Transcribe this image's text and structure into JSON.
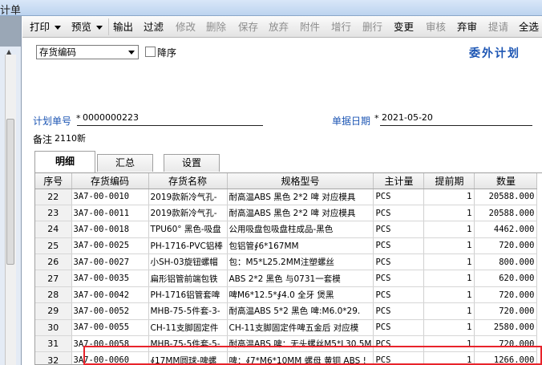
{
  "window": {
    "title": "计单"
  },
  "toolbar": {
    "buttons": [
      {
        "label": "打印",
        "dropdown": true,
        "disabled": false
      },
      {
        "label": "预览",
        "dropdown": true,
        "disabled": false
      },
      {
        "label": "输出",
        "dropdown": false,
        "disabled": false
      },
      {
        "label": "过滤",
        "dropdown": false,
        "disabled": false
      },
      {
        "label": "修改",
        "dropdown": false,
        "disabled": true
      },
      {
        "label": "删除",
        "dropdown": false,
        "disabled": true
      },
      {
        "label": "保存",
        "dropdown": false,
        "disabled": true
      },
      {
        "label": "放弃",
        "dropdown": false,
        "disabled": true
      },
      {
        "label": "附件",
        "dropdown": false,
        "disabled": true
      },
      {
        "label": "增行",
        "dropdown": false,
        "disabled": true
      },
      {
        "label": "删行",
        "dropdown": false,
        "disabled": true
      },
      {
        "label": "变更",
        "dropdown": false,
        "disabled": false
      },
      {
        "label": "审核",
        "dropdown": false,
        "disabled": true
      },
      {
        "label": "弃审",
        "dropdown": false,
        "disabled": false
      },
      {
        "label": "提请",
        "dropdown": false,
        "disabled": true
      },
      {
        "label": "全选",
        "dropdown": false,
        "disabled": false
      }
    ]
  },
  "filter": {
    "select_value": "存货编码",
    "checkbox_label": "降序",
    "checked": false
  },
  "form": {
    "title": "委外计划",
    "plan_no_label": "计划单号",
    "plan_no_value": "0000000223",
    "doc_date_label": "单据日期",
    "doc_date_value": "2021-05-20",
    "remark_label": "备注",
    "remark_value": "2110新",
    "required_mark": "*"
  },
  "tabs": [
    {
      "label": "明细",
      "active": true
    },
    {
      "label": "汇总",
      "active": false
    },
    {
      "label": "设置",
      "active": false
    }
  ],
  "table": {
    "columns": [
      "序号",
      "存货编码",
      "存货名称",
      "规格型号",
      "主计量",
      "提前期",
      "数量"
    ],
    "rows": [
      [
        "22",
        "3A7-00-0010",
        "2019款新冷气孔-",
        "耐高温ABS 黑色 2*2 啤 对应模具",
        "PCS",
        "1",
        "20588.000"
      ],
      [
        "23",
        "3A7-00-0011",
        "2019款新冷气孔-",
        "耐高温ABS 黑色 2*2 啤 对应模具",
        "PCS",
        "1",
        "20588.000"
      ],
      [
        "24",
        "3A7-00-0018",
        "TPU60° 黑色-吸盘",
        "公用吸盘包吸盘柱成品-黑色",
        "PCS",
        "1",
        "4462.000"
      ],
      [
        "25",
        "3A7-00-0025",
        "PH-1716-PVC铝棒",
        "包铝管∮6*167MM",
        "PCS",
        "1",
        "720.000"
      ],
      [
        "26",
        "3A7-00-0027",
        "小SH-03旋钮螺帽",
        "包：M5*L25.2MM注塑螺丝",
        "PCS",
        "1",
        "800.000"
      ],
      [
        "27",
        "3A7-00-0035",
        "扁形铝管前端包铁",
        "ABS 2*2 黑色 与0731一套模",
        "PCS",
        "1",
        "620.000"
      ],
      [
        "28",
        "3A7-00-0042",
        "PH-1716铝管套啤",
        "啤M6*12.5*∮4.0 全牙 煲黑",
        "PCS",
        "1",
        "720.000"
      ],
      [
        "29",
        "3A7-00-0052",
        "MHB-75-5件套-3-",
        "耐高温ABS 5*2 黑色 啤:M6.0*29.",
        "PCS",
        "1",
        "720.000"
      ],
      [
        "30",
        "3A7-00-0055",
        "CH-11支脚固定件",
        "CH-11支脚固定件啤五金后 对应模",
        "PCS",
        "1",
        "2580.000"
      ],
      [
        "31",
        "3A7-00-0058",
        "MHB-75-5件套-5-",
        "耐高温ABS 啤：无头螺丝M5*L30.5M",
        "PCS",
        "1",
        "720.000"
      ],
      [
        "32",
        "3A7-00-0060",
        "∮17MM圆球-啤螺",
        "啤：∮7*M6*10MM 螺母 黄铜 ABS !",
        "PCS",
        "1",
        "1266.000"
      ]
    ]
  },
  "colors": {
    "accent": "#1d56b4",
    "highlight": "#e8232b"
  }
}
